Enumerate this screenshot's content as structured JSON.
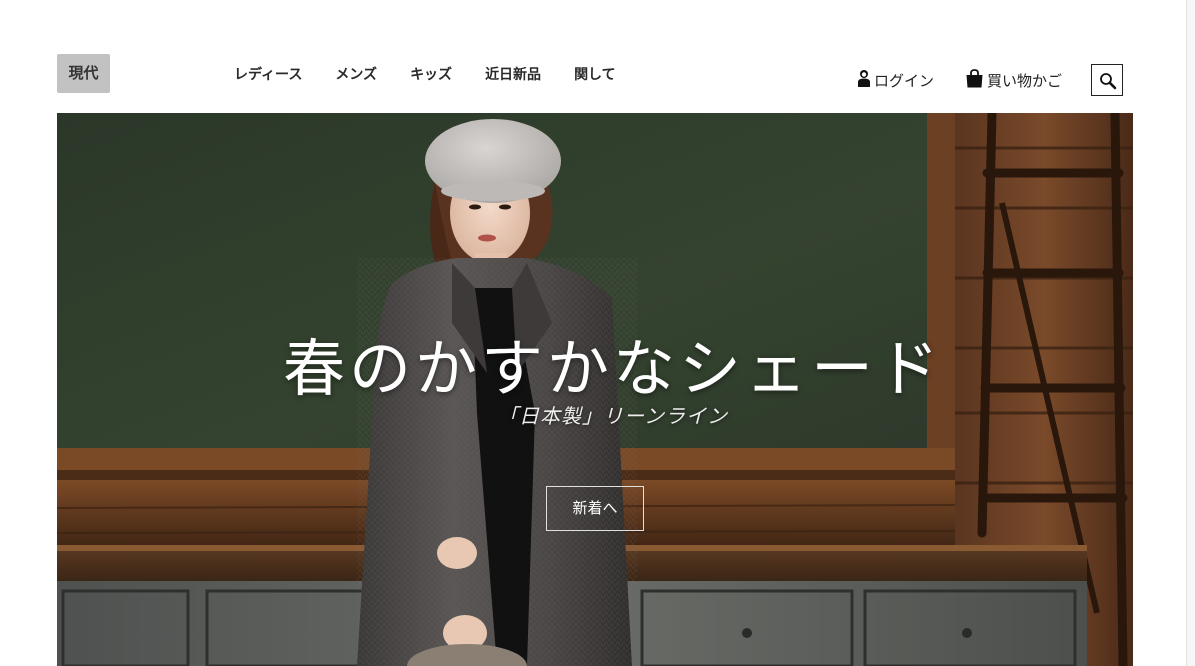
{
  "header": {
    "logo": "現代",
    "nav": [
      {
        "label": "レディース"
      },
      {
        "label": "メンズ"
      },
      {
        "label": "キッズ"
      },
      {
        "label": "近日新品"
      },
      {
        "label": "関して"
      }
    ],
    "login_label": "ログイン",
    "cart_label": "買い物かご",
    "icons": {
      "login": "person-icon",
      "cart": "shopping-bag-icon",
      "search": "search-icon"
    }
  },
  "hero": {
    "title": "春のかすかなシェード",
    "subtitle": "「日本製」リーンライン",
    "cta_label": "新着へ"
  },
  "colors": {
    "logo_bg": "#c2c2c2",
    "nav_text": "#2a2a2a",
    "chalkboard": "#2f3b2d",
    "wood": "#6b3f22",
    "coat": "#4a4746"
  }
}
